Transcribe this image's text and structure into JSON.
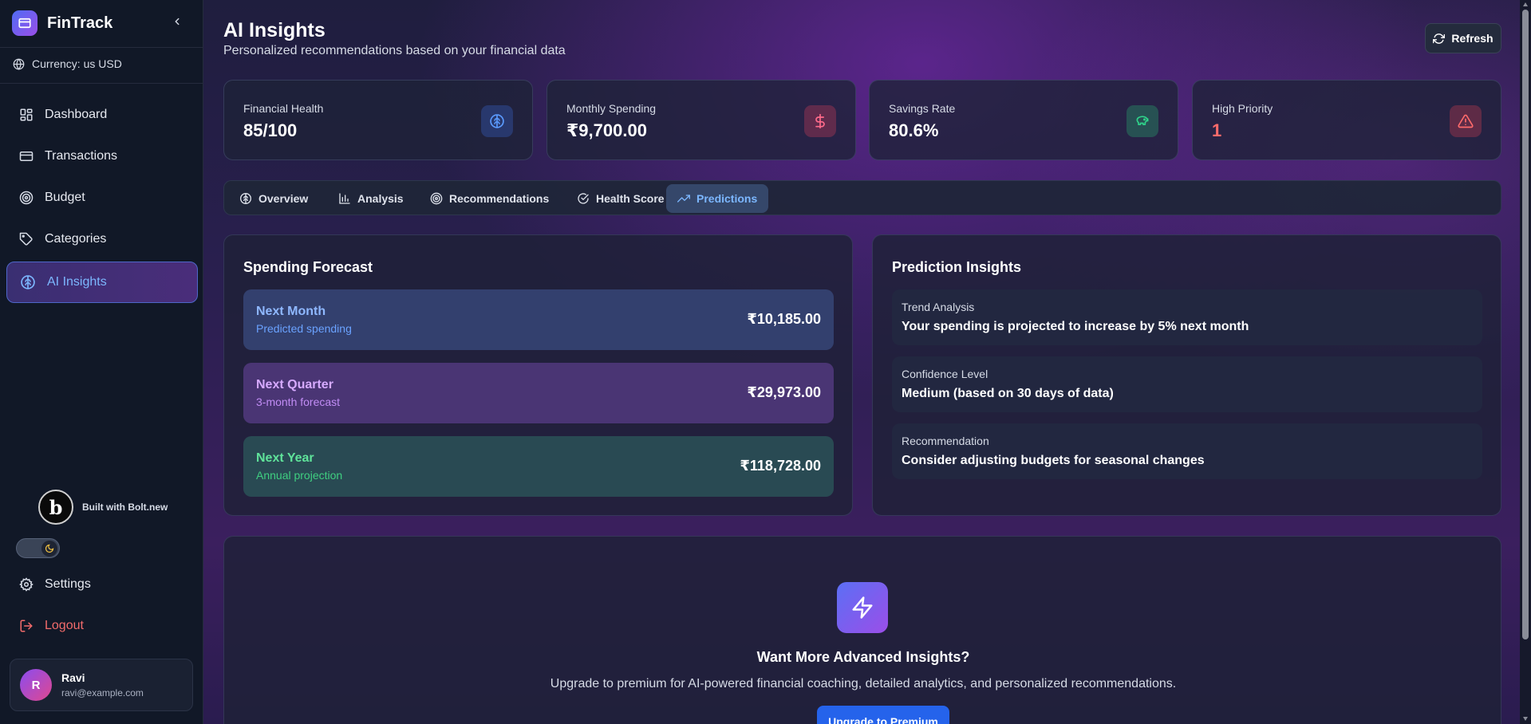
{
  "app": {
    "name": "FinTrack"
  },
  "sidebar": {
    "currency": "Currency: us USD",
    "items": [
      {
        "label": "Dashboard",
        "icon": "dashboard-icon"
      },
      {
        "label": "Transactions",
        "icon": "credit-card-icon"
      },
      {
        "label": "Budget",
        "icon": "target-icon"
      },
      {
        "label": "Categories",
        "icon": "tag-icon"
      },
      {
        "label": "AI Insights",
        "icon": "brain-icon",
        "active": true
      }
    ],
    "built_with": "Built with Bolt.new",
    "bolt_letter": "b",
    "settings": "Settings",
    "logout": "Logout",
    "user": {
      "initial": "R",
      "name": "Ravi",
      "email": "ravi@example.com"
    }
  },
  "header": {
    "title": "AI Insights",
    "subtitle": "Personalized recommendations based on your financial data",
    "refresh": "Refresh"
  },
  "stats": [
    {
      "label": "Financial Health",
      "value": "85/100",
      "icon": "brain-icon",
      "color": "#4a7fe0"
    },
    {
      "label": "Monthly Spending",
      "value": "₹9,700.00",
      "icon": "dollar-icon",
      "color": "#e0486a"
    },
    {
      "label": "Savings Rate",
      "value": "80.6%",
      "icon": "piggy-bank-icon",
      "color": "#2fd28a"
    },
    {
      "label": "High Priority",
      "value": "1",
      "icon": "alert-triangle-icon",
      "color": "#ff6b6b"
    }
  ],
  "tabs": [
    {
      "label": "Overview",
      "icon": "brain-icon"
    },
    {
      "label": "Analysis",
      "icon": "bar-chart-icon"
    },
    {
      "label": "Recommendations",
      "icon": "target-icon"
    },
    {
      "label": "Health Score",
      "icon": "check-circle-icon"
    },
    {
      "label": "Predictions",
      "icon": "trending-up-icon",
      "active": true
    }
  ],
  "forecast": {
    "title": "Spending Forecast",
    "items": [
      {
        "name": "Next Month",
        "sub": "Predicted spending",
        "value": "₹10,185.00"
      },
      {
        "name": "Next Quarter",
        "sub": "3-month forecast",
        "value": "₹29,973.00"
      },
      {
        "name": "Next Year",
        "sub": "Annual projection",
        "value": "₹118,728.00"
      }
    ]
  },
  "insights": {
    "title": "Prediction Insights",
    "items": [
      {
        "label": "Trend Analysis",
        "text": "Your spending is projected to increase by 5% next month"
      },
      {
        "label": "Confidence Level",
        "text": "Medium (based on 30 days of data)"
      },
      {
        "label": "Recommendation",
        "text": "Consider adjusting budgets for seasonal changes"
      }
    ]
  },
  "premium": {
    "title": "Want More Advanced Insights?",
    "description": "Upgrade to premium for AI-powered financial coaching, detailed analytics, and personalized recommendations.",
    "button": "Upgrade to Premium"
  }
}
